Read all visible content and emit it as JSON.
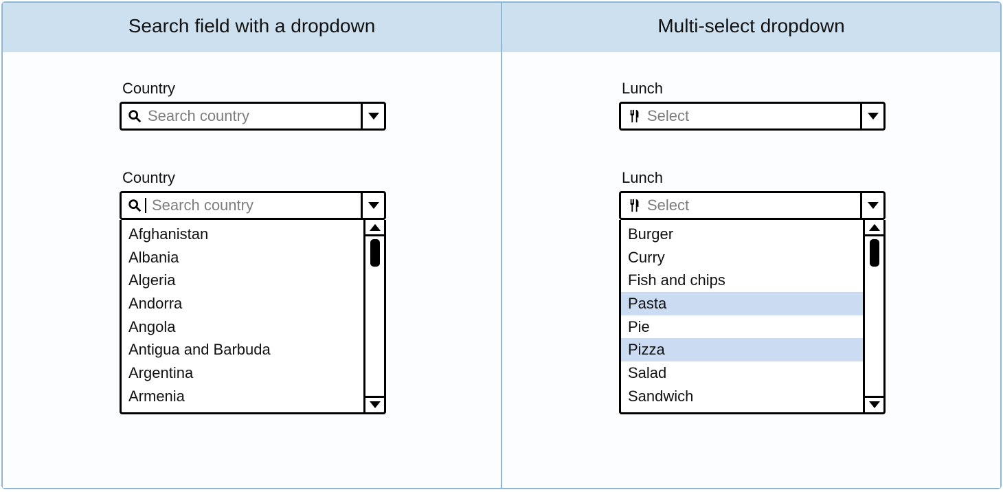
{
  "left": {
    "title": "Search field with a dropdown",
    "field_label": "Country",
    "placeholder": "Search country",
    "options": [
      "Afghanistan",
      "Albania",
      "Algeria",
      "Andorra",
      "Angola",
      "Antigua and Barbuda",
      "Argentina",
      "Armenia"
    ]
  },
  "right": {
    "title": "Multi-select dropdown",
    "field_label": "Lunch",
    "placeholder": "Select",
    "options": [
      {
        "label": "Burger",
        "selected": false
      },
      {
        "label": "Curry",
        "selected": false
      },
      {
        "label": "Fish and chips",
        "selected": false
      },
      {
        "label": "Pasta",
        "selected": true
      },
      {
        "label": "Pie",
        "selected": false
      },
      {
        "label": "Pizza",
        "selected": true
      },
      {
        "label": "Salad",
        "selected": false
      },
      {
        "label": "Sandwich",
        "selected": false
      }
    ]
  }
}
